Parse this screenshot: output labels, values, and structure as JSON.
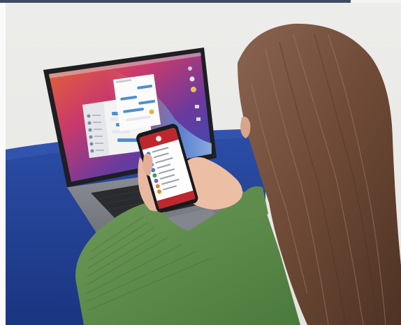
{
  "photo": {
    "subject": "woman-using-phone-and-laptop",
    "palette": {
      "wall": "#ececea",
      "table": "#1f3c8c",
      "sweater": "#5c8a4a",
      "hair": "#6e4a36",
      "phone_app_header": "#c0262c",
      "laptop_body": "#7b7e84",
      "frame_bar": "#3d4a63"
    }
  }
}
